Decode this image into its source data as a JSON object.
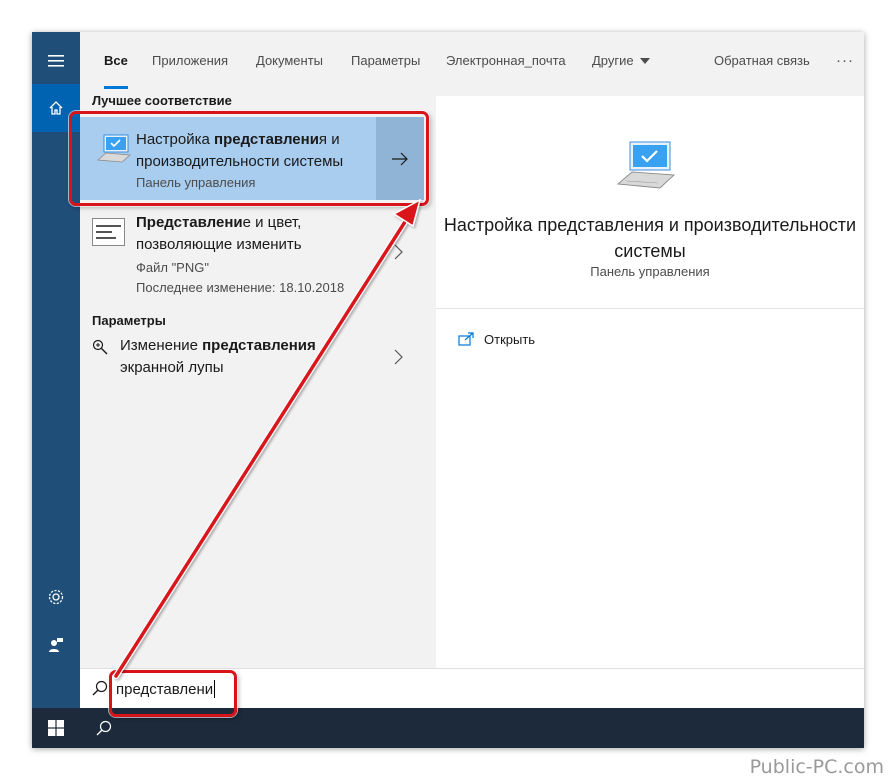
{
  "tabs": {
    "all": "Все",
    "apps": "Приложения",
    "documents": "Документы",
    "settings": "Параметры",
    "email": "Электронная_почта",
    "other": "Другие",
    "feedback": "Обратная связь",
    "more": "···"
  },
  "results": {
    "best_match_header": "Лучшее соответствие",
    "best_match": {
      "title_pre": "Настройка ",
      "title_bold": "представлени",
      "title_post": "я и производительности системы",
      "subtitle": "Панель управления"
    },
    "png_item": {
      "title_bold": "Представлени",
      "title_post": "е и цвет, позволяющие изменить",
      "type": "Файл \"PNG\"",
      "modified": "Последнее изменение: 18.10.2018"
    },
    "params_header": "Параметры",
    "magnifier_item": {
      "title_pre": "Изменение ",
      "title_bold": "представления",
      "title_post": " экранной лупы"
    }
  },
  "preview": {
    "title": "Настройка представления и производительности системы",
    "subtitle": "Панель управления",
    "action_open": "Открыть"
  },
  "search": {
    "query": "представлени"
  },
  "watermark": "Public-PC.com",
  "colors": {
    "accent": "#0078d7",
    "rail": "#1f4e79",
    "selected": "#a8cdef",
    "annotation": "#d8141b"
  }
}
